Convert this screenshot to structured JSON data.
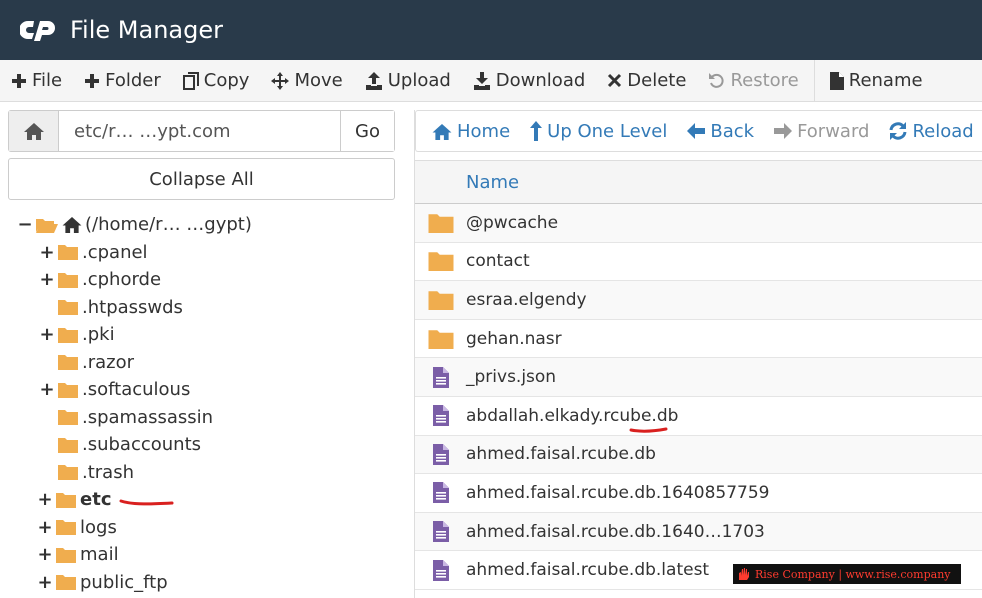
{
  "header": {
    "title": "File Manager"
  },
  "toolbar": {
    "file": "File",
    "folder": "Folder",
    "copy": "Copy",
    "move": "Move",
    "upload": "Upload",
    "download": "Download",
    "delete": "Delete",
    "restore": "Restore",
    "rename": "Rename"
  },
  "path": {
    "value": "etc/r… …ypt.com",
    "go": "Go"
  },
  "collapse_all": "Collapse All",
  "tree": {
    "root": "(/home/r… …gypt)",
    "items": [
      {
        "label": ".cpanel",
        "expandable": true
      },
      {
        "label": ".cphorde",
        "expandable": true
      },
      {
        "label": ".htpasswds",
        "expandable": false
      },
      {
        "label": ".pki",
        "expandable": true
      },
      {
        "label": ".razor",
        "expandable": false
      },
      {
        "label": ".softaculous",
        "expandable": true
      },
      {
        "label": ".spamassassin",
        "expandable": false
      },
      {
        "label": ".subaccounts",
        "expandable": false
      },
      {
        "label": ".trash",
        "expandable": false
      }
    ],
    "top_items": [
      {
        "label": "etc",
        "bold": true
      },
      {
        "label": "logs",
        "bold": false
      },
      {
        "label": "mail",
        "bold": false
      },
      {
        "label": "public_ftp",
        "bold": false
      }
    ]
  },
  "nav": {
    "home": "Home",
    "up": "Up One Level",
    "back": "Back",
    "forward": "Forward",
    "reload": "Reload"
  },
  "table": {
    "header_name": "Name",
    "rows": [
      {
        "name": "@pwcache",
        "type": "folder"
      },
      {
        "name": "contact",
        "type": "folder"
      },
      {
        "name": "esraa.elgendy",
        "type": "folder"
      },
      {
        "name": "gehan.nasr",
        "type": "folder"
      },
      {
        "name": "_privs.json",
        "type": "file"
      },
      {
        "name": "abdallah.elkady.rcube.db",
        "type": "file"
      },
      {
        "name": "ahmed.faisal.rcube.db",
        "type": "file"
      },
      {
        "name": "ahmed.faisal.rcube.db.1640857759",
        "type": "file"
      },
      {
        "name": "ahmed.faisal.rcube.db.1640…1703",
        "type": "file"
      },
      {
        "name": "ahmed.faisal.rcube.db.latest",
        "type": "file"
      }
    ]
  },
  "watermark": "Rise Company | www.rise.company",
  "colors": {
    "header_bg": "#293a4a",
    "link": "#337ab7",
    "folder": "#f0ad4e",
    "file": "#7b5ea7",
    "annotation": "#d9201f"
  }
}
